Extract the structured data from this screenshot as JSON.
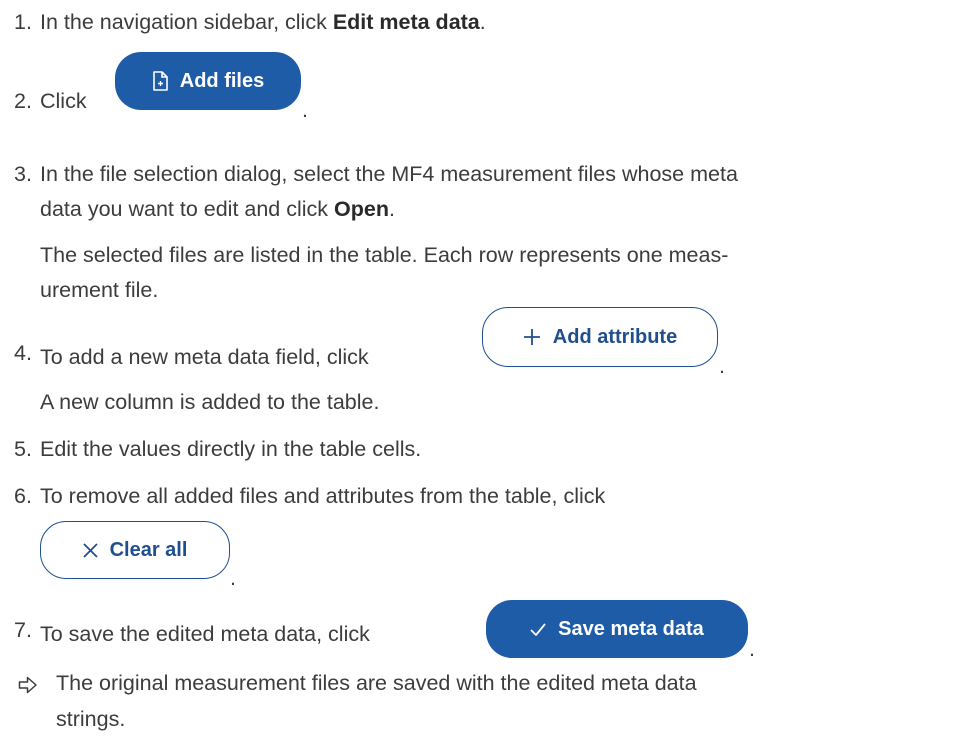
{
  "steps": [
    {
      "num": "1.",
      "pre": "In the navigation sidebar, click ",
      "bold": "Edit meta data",
      "post": "."
    },
    {
      "num": "2.",
      "pre": "Click",
      "button": "Add files",
      "post": "."
    },
    {
      "num": "3.",
      "line1": "In the file selection dialog, select the MF4 measurement files whose meta",
      "line2_pre": "data you want to edit and click ",
      "line2_bold": "Open",
      "line2_post": ".",
      "note1": "The selected files are listed in the table. Each row represents one meas-",
      "note2": "urement file."
    },
    {
      "num": "4.",
      "pre": "To add a new meta data field, click",
      "button": "Add attribute",
      "post": ".",
      "note": "A new column is added to the table."
    },
    {
      "num": "5.",
      "text": "Edit the values directly in the table cells."
    },
    {
      "num": "6.",
      "text": "To remove all added files and attributes from the table, click",
      "button": "Clear all",
      "post": "."
    },
    {
      "num": "7.",
      "pre": "To save the edited meta data, click",
      "button": "Save meta data",
      "post": "."
    }
  ],
  "result": {
    "icon": "arrow-right-icon",
    "line1": "The original measurement files are saved with the edited meta data",
    "line2": "strings."
  },
  "colors": {
    "accent": "#1f5ca8",
    "outline": "#1f4f8f"
  }
}
